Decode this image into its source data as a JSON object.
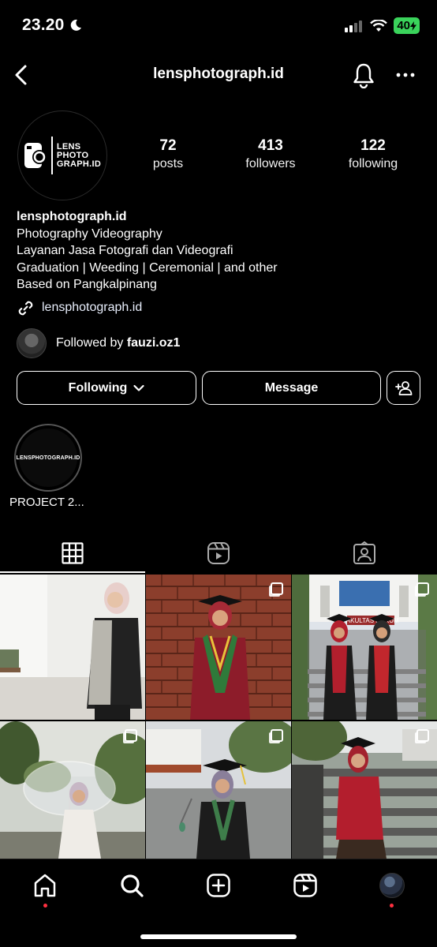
{
  "status": {
    "time": "23.20",
    "battery": "40"
  },
  "nav": {
    "title": "lensphotograph.id"
  },
  "profile": {
    "logo_lines": [
      "LENS",
      "PHOTO",
      "GRAPH.ID"
    ],
    "stats": [
      {
        "value": "72",
        "label": "posts"
      },
      {
        "value": "413",
        "label": "followers"
      },
      {
        "value": "122",
        "label": "following"
      }
    ],
    "name": "lensphotograph.id",
    "bio": [
      "Photography Videography",
      "Layanan Jasa Fotografi dan Videografi",
      "Graduation | Weeding | Ceremonial | and other",
      "Based on Pangkalpinang"
    ],
    "link": "lensphotograph.id",
    "followed_by_prefix": "Followed by ",
    "followed_by_user": "fauzi.oz1"
  },
  "actions": {
    "following": "Following",
    "message": "Message"
  },
  "highlights": [
    {
      "label": "PROJECT 2...",
      "cover_text": "LENSPHOTOGRAPH.ID"
    }
  ],
  "tabs": [
    "grid-icon",
    "reels-icon",
    "tagged-icon"
  ],
  "posts": [
    {
      "subject": "hijab model white wall",
      "multi": false
    },
    {
      "subject": "graduate red brick wall",
      "multi": true
    },
    {
      "subject": "two graduates stairs FAKULTAS",
      "multi": true,
      "sign": "FAKULTAS HUKUM"
    },
    {
      "subject": "woman umbrella garden",
      "multi": true
    },
    {
      "subject": "graduate road",
      "multi": true
    },
    {
      "subject": "graduate stone stairs",
      "multi": true
    }
  ],
  "bottom_nav": [
    "home-icon",
    "search-icon",
    "create-icon",
    "reels-icon",
    "profile-avatar"
  ]
}
